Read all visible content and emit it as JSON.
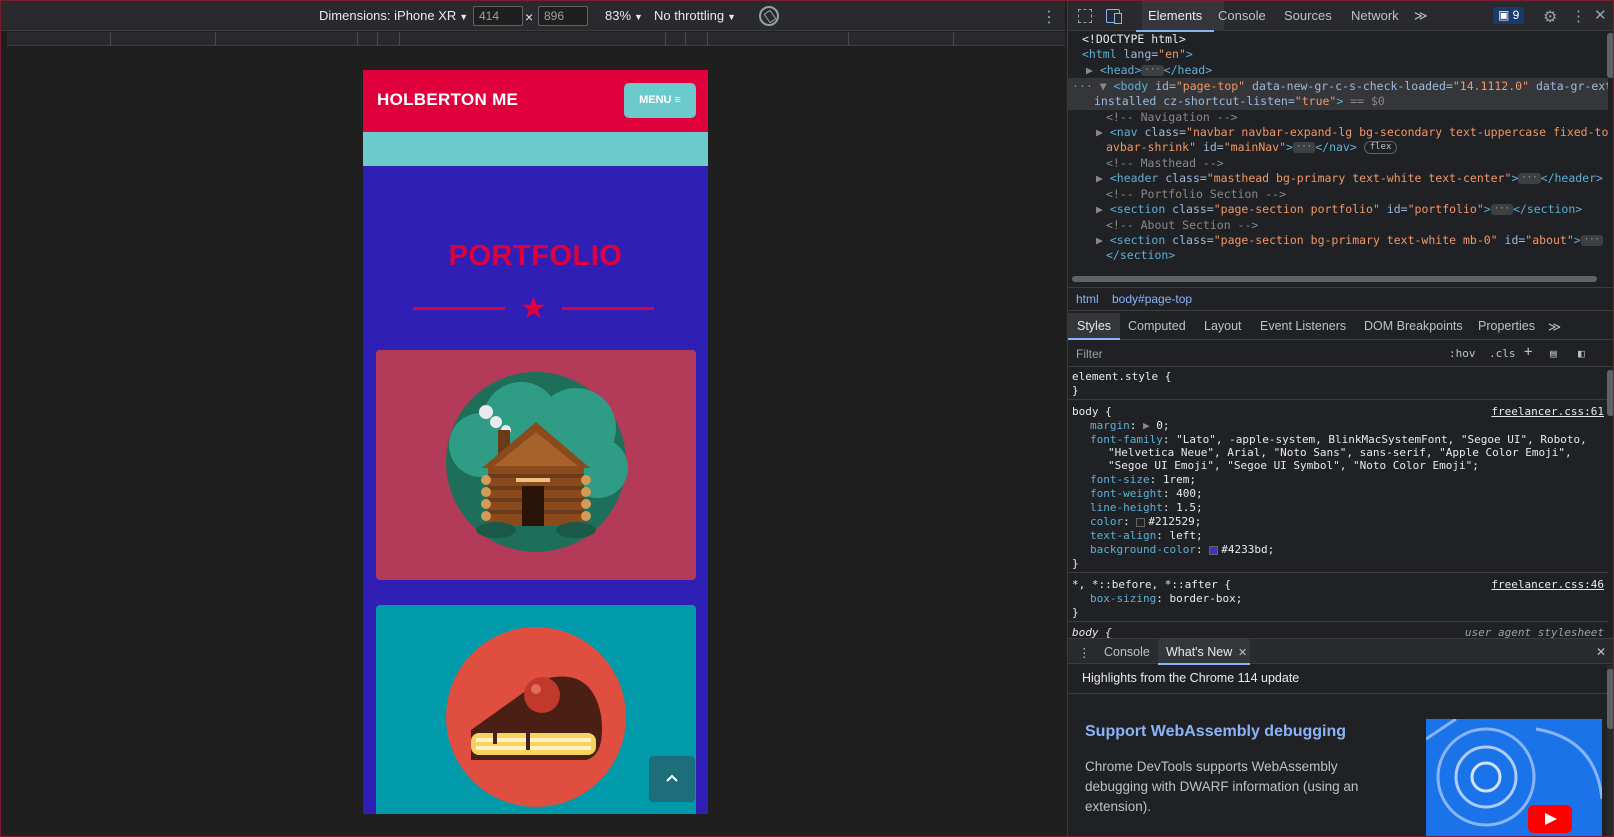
{
  "device_toolbar": {
    "dimensions_label": "Dimensions: iPhone XR",
    "width_value": "414",
    "times": "×",
    "height_value": "896",
    "zoom": "83%",
    "throttling": "No throttling"
  },
  "mobile_page": {
    "brand": "HOLBERTON ME",
    "menu_label": "MENU",
    "section_title": "PORTFOLIO",
    "colors": {
      "navbar": "#e0003c",
      "accent": "#6cc9cc",
      "primary": "#2f1fb5",
      "card1": "#b43a5a",
      "card2": "#009aab"
    }
  },
  "devtools": {
    "tabs": [
      "Elements",
      "Console",
      "Sources",
      "Network"
    ],
    "issues_count": "9",
    "dom_lines": {
      "l1": "<!DOCTYPE html>",
      "html_tag": "<html",
      "html_attr": " lang=",
      "html_val": "\"en\"",
      "html_close": ">",
      "head_open": "<head>",
      "head_close": "</head>",
      "body_tag": "<body",
      "body_attr1": " id=",
      "body_val1": "\"page-top\"",
      "body_attr2": " data-new-gr-c-s-check-loaded=",
      "body_val2": "\"14.1112.0\"",
      "body_attr3": " data-gr-ext-",
      "body_attr3b": "installed",
      "body_attr4": " cz-shortcut-listen=",
      "body_val4": "\"true\"",
      "body_close": ">",
      "body_eq": " == $0",
      "c_nav": "<!-- Navigation -->",
      "nav_tag": "<nav",
      "nav_attr": " class=",
      "nav_val": "\"navbar navbar-expand-lg bg-secondary text-uppercase fixed-top n",
      "nav_val2": "avbar-shrink\"",
      "nav_attr2": " id=",
      "nav_val3": "\"mainNav\"",
      "nav_close": "</nav>",
      "flex_badge": "flex",
      "c_mast": "<!-- Masthead -->",
      "header_tag": "<header",
      "header_attr": " class=",
      "header_val": "\"masthead bg-primary text-white text-center\"",
      "header_close": "</header>",
      "c_port": "<!-- Portfolio Section -->",
      "sec_tag": "<section",
      "sec_attr": " class=",
      "sec_val": "\"page-section portfolio\"",
      "sec_attr2": " id=",
      "sec_val2": "\"portfolio\"",
      "sec_close": "</section>",
      "c_about": "<!-- About Section -->",
      "sec2_val": "\"page-section bg-primary text-white mb-0\"",
      "sec2_val2": "\"about\"",
      "sec2_close": "</section>",
      "ellipsis": "···"
    },
    "breadcrumbs": [
      "html",
      "body#page-top"
    ],
    "styles_tabs": [
      "Styles",
      "Computed",
      "Layout",
      "Event Listeners",
      "DOM Breakpoints",
      "Properties"
    ],
    "filter_placeholder": "Filter",
    "hov": ":hov",
    "cls": ".cls",
    "styles": {
      "element_style": "element.style {",
      "close": "}",
      "body_sel": "body {",
      "body_src": "freelancer.css:61",
      "margin_p": "margin",
      "margin_v": "0;",
      "ff_p": "font-family",
      "ff_v1": "\"Lato\", -apple-system, BlinkMacSystemFont, \"Segoe UI\", Roboto,",
      "ff_v2": "\"Helvetica Neue\", Arial, \"Noto Sans\", sans-serif, \"Apple Color Emoji\",",
      "ff_v3": "\"Segoe UI Emoji\", \"Segoe UI Symbol\", \"Noto Color Emoji\";",
      "fs_p": "font-size",
      "fs_v": "1rem;",
      "fw_p": "font-weight",
      "fw_v": "400;",
      "lh_p": "line-height",
      "lh_v": "1.5;",
      "color_p": "color",
      "color_v": "#212529;",
      "ta_p": "text-align",
      "ta_v": "left;",
      "bg_p": "background-color",
      "bg_v": "#4233bd;",
      "star_sel": "*, *::before, *::after {",
      "star_src": "freelancer.css:46",
      "bs_p": "box-sizing",
      "bs_v": "border-box;",
      "body2_sel": "body {",
      "ua_src": "user agent stylesheet",
      "swatch_color": "#212529",
      "swatch_bg": "#4233bd"
    },
    "drawer_tabs": [
      "Console",
      "What's New"
    ],
    "whats_new": {
      "heading": "Highlights from the Chrome 114 update",
      "title": "Support WebAssembly debugging",
      "body": "Chrome DevTools supports WebAssembly debugging with DWARF information (using an extension)."
    }
  }
}
